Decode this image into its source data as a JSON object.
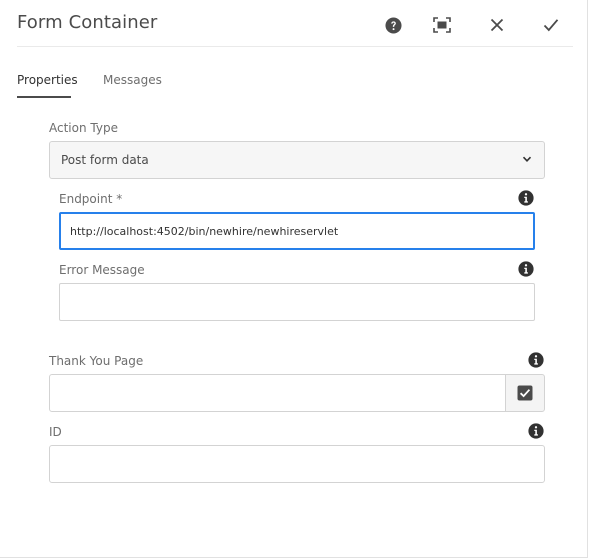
{
  "dialog": {
    "title": "Form Container",
    "header_buttons": [
      {
        "name": "help",
        "icon": "help-icon"
      },
      {
        "name": "fullscreen",
        "icon": "fullscreen-icon"
      },
      {
        "name": "close",
        "icon": "close-icon"
      },
      {
        "name": "done",
        "icon": "checkmark-icon"
      }
    ]
  },
  "tabs": [
    {
      "label": "Properties",
      "active": true
    },
    {
      "label": "Messages",
      "active": false
    }
  ],
  "form": {
    "action_type": {
      "label": "Action Type",
      "value": "Post form data"
    },
    "endpoint": {
      "label": "Endpoint *",
      "value": "http://localhost:4502/bin/newhire/newhireservlet"
    },
    "error_message": {
      "label": "Error Message",
      "value": ""
    },
    "thank_you_page": {
      "label": "Thank You Page",
      "value": ""
    },
    "id": {
      "label": "ID",
      "value": ""
    }
  },
  "colors": {
    "focus": "#2680eb",
    "text": "#4b4b4b",
    "label": "#6e6e6e",
    "icon": "#4b4b4b"
  }
}
